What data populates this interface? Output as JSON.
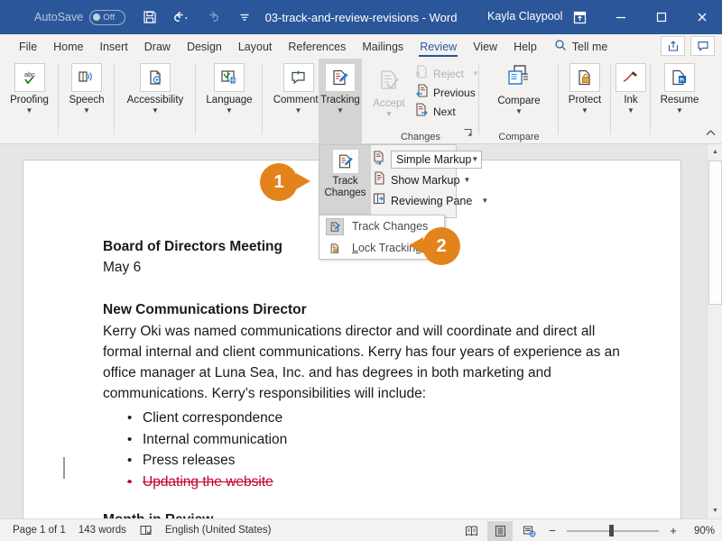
{
  "titlebar": {
    "autosave_label": "AutoSave",
    "autosave_state": "Off",
    "document_title": "03-track-and-review-revisions - Word",
    "user_name": "Kayla Claypool",
    "quick_access": [
      "save-icon",
      "undo-icon",
      "redo-icon",
      "customize-qat-icon"
    ],
    "window_controls": [
      "ribbon-display-options-icon",
      "minimize-icon",
      "maximize-icon",
      "close-icon"
    ],
    "bg_color": "#2b579a"
  },
  "tabs": [
    {
      "label": "File",
      "active": false
    },
    {
      "label": "Home",
      "active": false
    },
    {
      "label": "Insert",
      "active": false
    },
    {
      "label": "Draw",
      "active": false
    },
    {
      "label": "Design",
      "active": false
    },
    {
      "label": "Layout",
      "active": false
    },
    {
      "label": "References",
      "active": false
    },
    {
      "label": "Mailings",
      "active": false
    },
    {
      "label": "Review",
      "active": true
    },
    {
      "label": "View",
      "active": false
    },
    {
      "label": "Help",
      "active": false
    }
  ],
  "tellme": {
    "label": "Tell me",
    "icon": "search-icon"
  },
  "topright": {
    "share_icon": "share-icon",
    "comments_icon": "comments-icon"
  },
  "ribbon": {
    "groups": [
      {
        "label": "Proofing",
        "button": "Proofing",
        "icon": "spelling-abc-check-icon"
      },
      {
        "label": "Speech",
        "button": "Speech",
        "icon": "read-aloud-icon"
      },
      {
        "label": "Accessibility",
        "button": "Accessibility",
        "icon": "check-accessibility-icon"
      },
      {
        "label": "Language",
        "button": "Language",
        "icon": "translate-globe-icon"
      },
      {
        "label": "Comments",
        "button": "Comments",
        "icon": "new-comment-icon"
      },
      {
        "label": "Tracking",
        "button": "Tracking",
        "icon": "track-changes-pencil-icon",
        "highlighted": true
      },
      {
        "label": "Changes",
        "button": "Accept",
        "icon": "accept-check-icon",
        "disabled": true
      },
      {
        "label": "Compare",
        "button": "Compare",
        "icon": "compare-documents-icon"
      },
      {
        "label": "",
        "button": "Protect",
        "icon": "protect-lock-icon"
      },
      {
        "label": "",
        "button": "Ink",
        "icon": "ink-pen-icon"
      },
      {
        "label": "",
        "button": "Resume",
        "icon": "resume-linkedin-icon"
      }
    ],
    "changes_items": [
      {
        "label": "Reject",
        "icon": "reject-icon",
        "disabled": true,
        "has_caret": true
      },
      {
        "label": "Previous",
        "icon": "previous-change-icon",
        "disabled": false,
        "has_caret": false
      },
      {
        "label": "Next",
        "icon": "next-change-icon",
        "disabled": false,
        "has_caret": false
      }
    ],
    "collapse_icon": "collapse-ribbon-icon",
    "dialog_launcher_icon": "dialog-launcher-icon"
  },
  "tracking_flyout": {
    "track_changes_button": {
      "line1": "Track",
      "line2": "Changes",
      "icon": "track-changes-pencil-icon"
    },
    "markup_display": {
      "value": "Simple Markup",
      "icon": "display-for-review-icon"
    },
    "show_markup": {
      "label": "Show Markup",
      "icon": "show-markup-icon"
    },
    "reviewing_pane": {
      "label": "Reviewing Pane",
      "icon": "reviewing-pane-icon"
    }
  },
  "tracking_menu": {
    "items": [
      {
        "label": "Track Changes",
        "label_pre": "Track Chan",
        "label_key": "g",
        "label_post": "es",
        "icon": "track-changes-pencil-icon",
        "checked": true
      },
      {
        "label": "Lock Tracking",
        "label_pre": "",
        "label_key": "L",
        "label_post": "ock Tracking",
        "icon": "lock-tracking-icon",
        "checked": false
      }
    ]
  },
  "callouts": [
    {
      "number": "1",
      "color": "#e2841b",
      "points": "right"
    },
    {
      "number": "2",
      "color": "#e2841b",
      "points": "left"
    }
  ],
  "document": {
    "title_line": "Board of Directors Meeting",
    "date_line": "May 6",
    "section_heading": "New Communications Director",
    "paragraph": "Kerry Oki was named communications director and will coordinate and direct all formal internal and client communications. Kerry has four years of experience as an office manager at Luna Sea, Inc. and has degrees in both marketing and communications. Kerry’s responsibilities will include:",
    "bullets": [
      {
        "text": "Client correspondence",
        "deleted": false
      },
      {
        "text": "Internal communication",
        "deleted": false
      },
      {
        "text": "Press releases",
        "deleted": false
      },
      {
        "text": "Updating the website",
        "deleted": true
      }
    ],
    "second_heading": "Month in Review",
    "deleted_color": "#c00030"
  },
  "statusbar": {
    "page": "Page 1 of 1",
    "words": "143 words",
    "proofing_icon": "proofing-errors-icon",
    "language": "English (United States)",
    "view_buttons": [
      {
        "icon": "read-mode-icon",
        "selected": false
      },
      {
        "icon": "print-layout-icon",
        "selected": true
      },
      {
        "icon": "web-layout-icon",
        "selected": false
      }
    ],
    "zoom_out": "−",
    "zoom_in": "+",
    "zoom_value": "90%"
  }
}
